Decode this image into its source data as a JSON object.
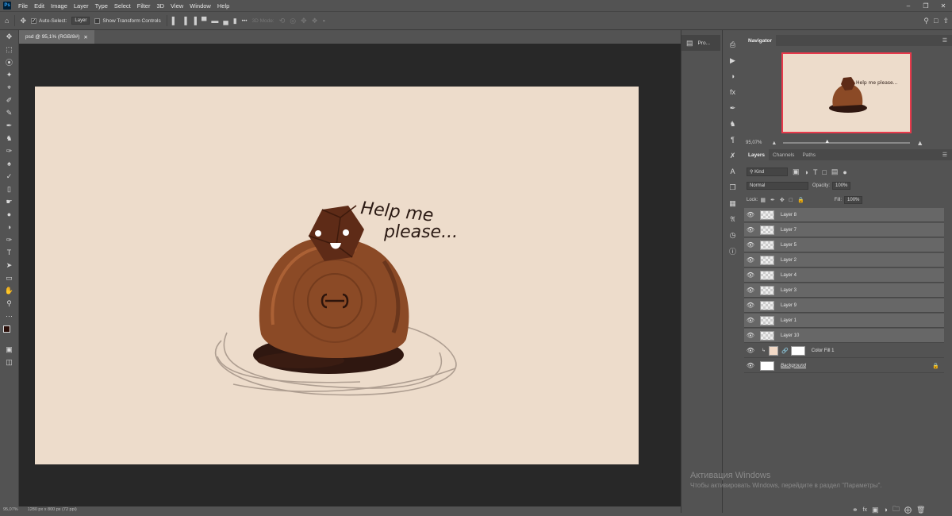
{
  "app": {
    "logo": "Ps"
  },
  "menu": [
    "File",
    "Edit",
    "Image",
    "Layer",
    "Type",
    "Select",
    "Filter",
    "3D",
    "View",
    "Window",
    "Help"
  ],
  "options_bar": {
    "auto_select_label": "Auto-Select:",
    "auto_select_target": "Layer",
    "transform_label": "Show Transform Controls",
    "mode_3d_label": "3D Mode:",
    "more_label": "•••"
  },
  "document": {
    "tab_title": "psd @ 95,1% (RGB/8#)",
    "canvas_text_line1": "Help me",
    "canvas_text_line2": "please...",
    "canvas_color": "#eddccb"
  },
  "status": {
    "zoom": "95,07%",
    "doc_size": "1280 px x 800 px (72 ppi)"
  },
  "collapsed_panel": {
    "label": "Pro..."
  },
  "navigator": {
    "title": "Navigator",
    "zoom": "95,07%",
    "mini_text": "Help me please..."
  },
  "layers": {
    "tabs": [
      "Layers",
      "Channels",
      "Paths"
    ],
    "filter_kind": "Kind",
    "blend_mode": "Normal",
    "opacity_label": "Opacity:",
    "opacity_value": "100%",
    "lock_label": "Lock:",
    "fill_label": "Fill:",
    "fill_value": "100%",
    "items": [
      {
        "name": "Layer 8"
      },
      {
        "name": "Layer 7"
      },
      {
        "name": "Layer 5"
      },
      {
        "name": "Layer 2"
      },
      {
        "name": "Layer 4"
      },
      {
        "name": "Layer 3"
      },
      {
        "name": "Layer 9"
      },
      {
        "name": "Layer 1"
      },
      {
        "name": "Layer 10"
      },
      {
        "name": "Color Fill 1"
      },
      {
        "name": "Background"
      }
    ]
  },
  "watermark": {
    "line1": "Активация Windows",
    "line2": "Чтобы активировать Windows, перейдите в раздел \"Параметры\"."
  },
  "colors": {
    "accent": "#e8394b",
    "foreground": "#2a0f0a",
    "background": "#ffffff"
  }
}
